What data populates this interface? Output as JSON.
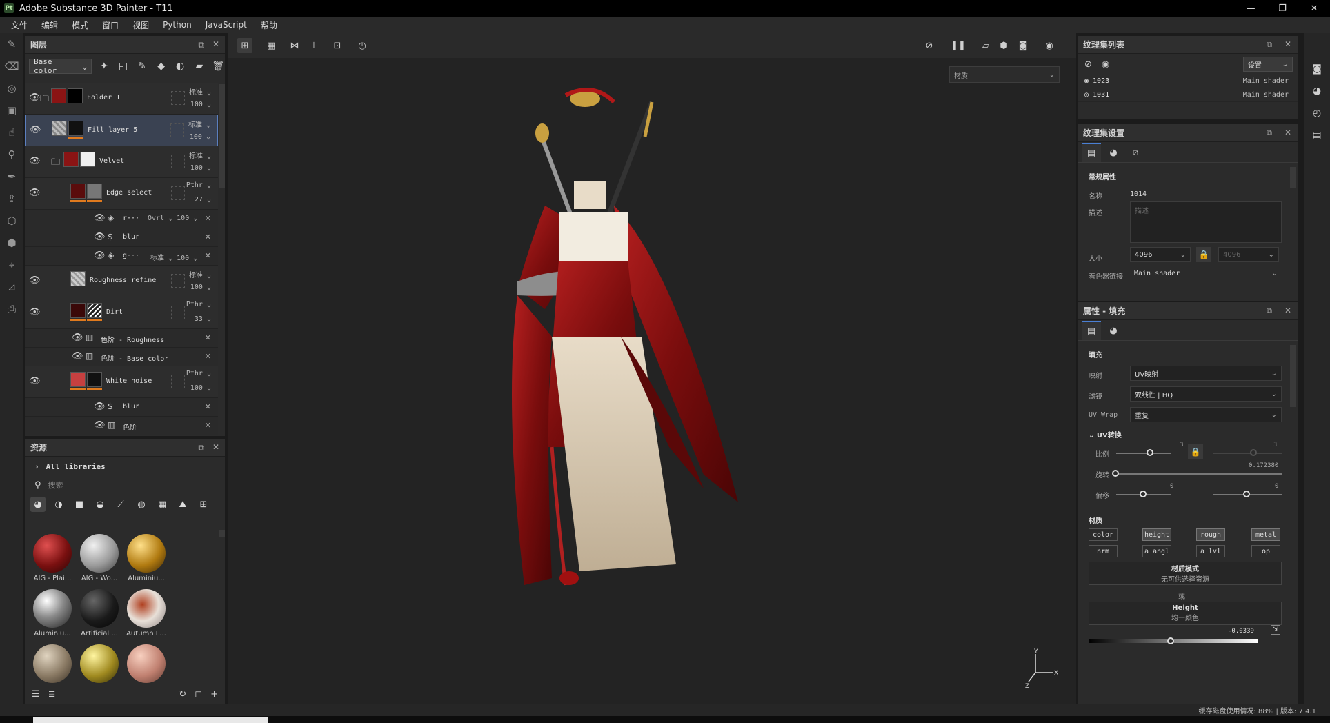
{
  "titlebar": {
    "title": "Adobe Substance 3D Painter - T11",
    "logo": "Pt",
    "minimize": "—",
    "restore": "❐",
    "close": "✕"
  },
  "menu": [
    "文件",
    "编辑",
    "模式",
    "窗口",
    "视图",
    "Python",
    "JavaScript",
    "帮助"
  ],
  "layers_panel": {
    "title": "图层",
    "channel_select": "Base color",
    "layers": [
      {
        "name": "Folder 1",
        "blend": "标准",
        "opacity": "100"
      },
      {
        "name": "Fill layer 5",
        "blend": "标准",
        "opacity": "100"
      },
      {
        "name": "Velvet",
        "blend": "标准",
        "opacity": "100"
      },
      {
        "name": "Edge select",
        "blend": "Pthr",
        "opacity": "27"
      },
      {
        "name": "r···",
        "blend": "Ovrl",
        "opacity": "100"
      },
      {
        "name": "blur"
      },
      {
        "name": "g···",
        "blend": "标准",
        "opacity": "100"
      },
      {
        "name": "Roughness refine",
        "blend": "标准",
        "opacity": "100"
      },
      {
        "name": "Dirt",
        "blend": "Pthr",
        "opacity": "33"
      },
      {
        "name": "色阶 - Roughness"
      },
      {
        "name": "色阶 - Base color"
      },
      {
        "name": "White noise",
        "blend": "Pthr",
        "opacity": "100"
      },
      {
        "name": "blur"
      },
      {
        "name": "色阶"
      }
    ]
  },
  "assets_panel": {
    "title": "资源",
    "library": "All libraries",
    "search_placeholder": "搜索",
    "items": [
      {
        "label": "AIG - Plai..."
      },
      {
        "label": "AIG - Wo..."
      },
      {
        "label": "Aluminiu..."
      },
      {
        "label": "Aluminiu..."
      },
      {
        "label": "Artificial ..."
      },
      {
        "label": "Autumn L..."
      },
      {
        "label": ""
      },
      {
        "label": ""
      },
      {
        "label": ""
      }
    ]
  },
  "viewport": {
    "display_select": "材质",
    "axis_y": "Y",
    "axis_x": "X",
    "axis_z": "Z"
  },
  "texture_set_list": {
    "title": "纹理集列表",
    "settings_label": "设置",
    "rows": [
      {
        "name": "1023",
        "shader": "Main shader"
      },
      {
        "name": "1031",
        "shader": "Main shader"
      }
    ]
  },
  "texture_set_settings": {
    "title": "纹理集设置",
    "section": "常规属性",
    "name_label": "名称",
    "name_value": "1014",
    "desc_label": "描述",
    "desc_placeholder": "描述",
    "size_label": "大小",
    "size_value": "4096",
    "size_value2": "4096",
    "shader_label": "着色器链接",
    "shader_value": "Main shader"
  },
  "properties_fill": {
    "title": "属性 - 填充",
    "section_fill": "填充",
    "mapping_label": "映射",
    "mapping_value": "UV映射",
    "filter_label": "滤镜",
    "filter_value": "双线性 | HQ",
    "uvwrap_label": "UV Wrap",
    "uvwrap_value": "重复",
    "uv_transform": "UV转换",
    "scale_label": "比例",
    "scale_value": "3",
    "scale_value2": "3",
    "rotation_label": "旋转",
    "rotation_value": "0.172380",
    "offset_label": "偏移",
    "offset_value": "0",
    "offset_value2": "0",
    "material_section": "材质",
    "channels": [
      "color",
      "height",
      "rough",
      "metal",
      "nrm",
      "a angl",
      "a lvl",
      "op"
    ],
    "material_mode_title": "材质模式",
    "material_mode_sub": "无可供选择资源",
    "or_label": "或",
    "height_title": "Height",
    "height_sub": "均一颜色",
    "height_value": "-0.0339"
  },
  "status": {
    "text": "缓存磁盘使用情况:  88%  |  版本:  7.4.1"
  },
  "colors": {
    "accent": "#4a7fd4",
    "orange": "#e07a1e",
    "red": "#9a1a1a"
  }
}
